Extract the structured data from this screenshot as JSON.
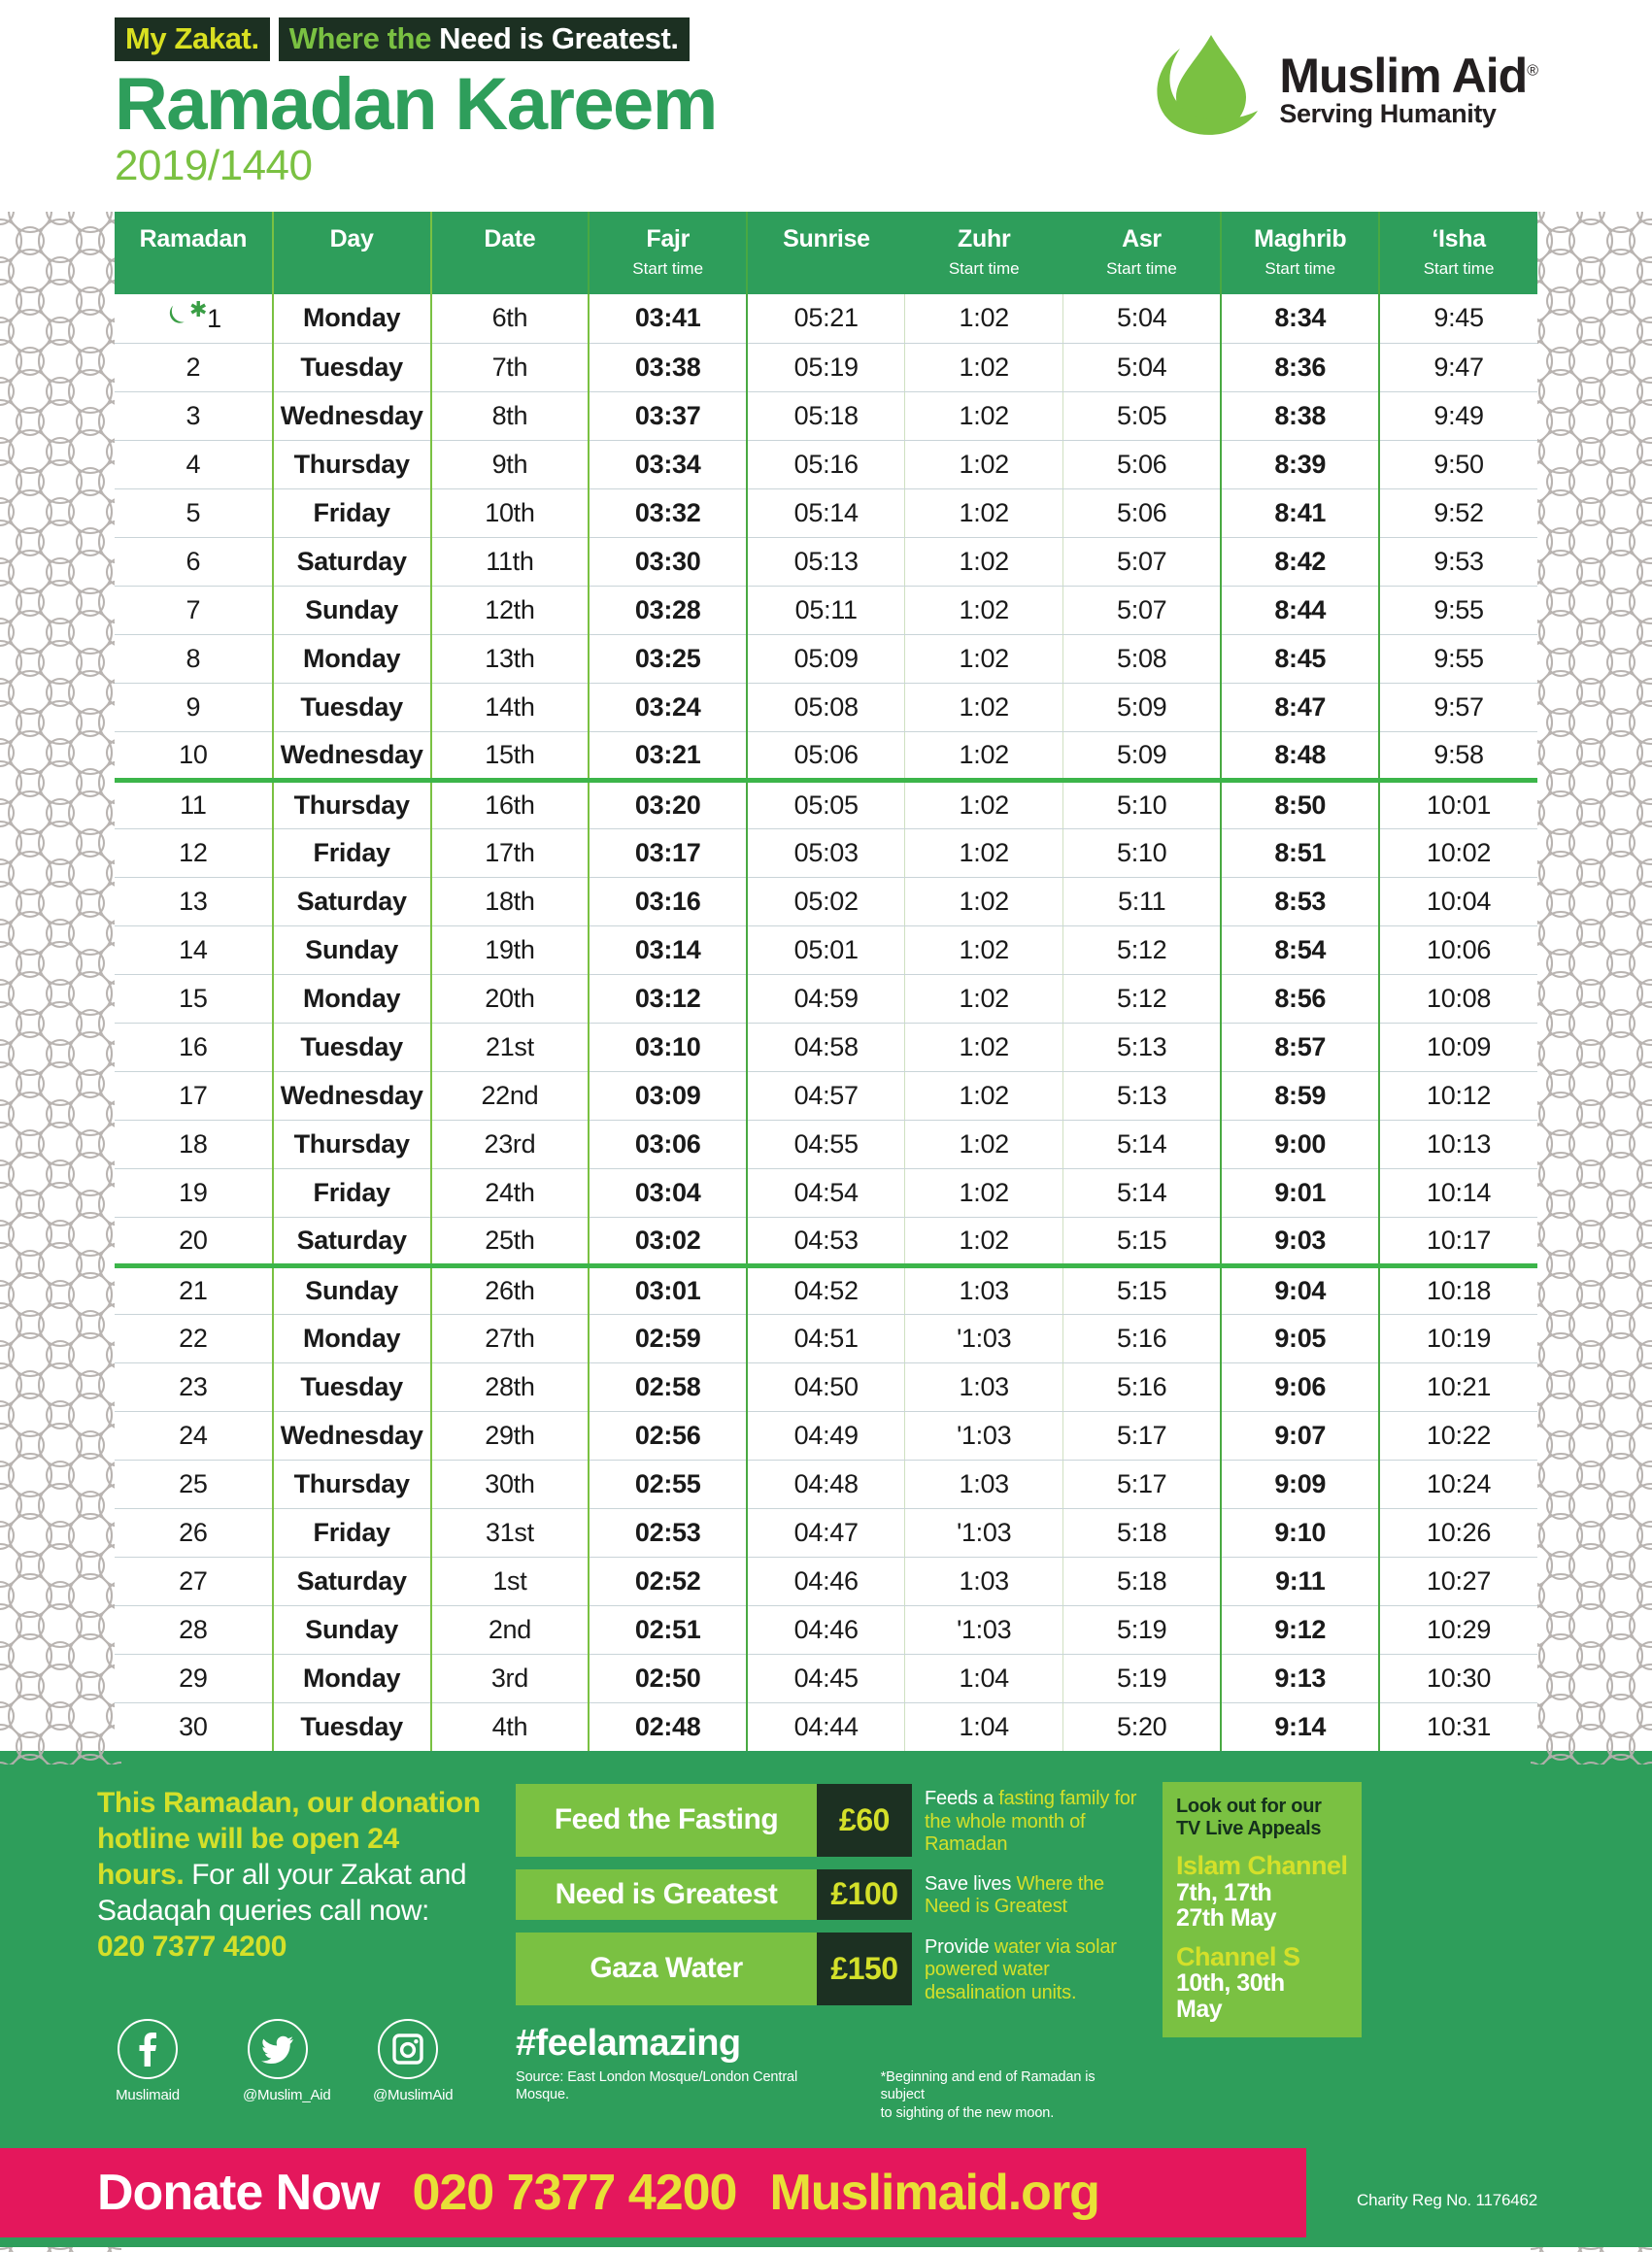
{
  "header": {
    "tagline_part1": "My Zakat.",
    "tagline_part2": "Where the",
    "tagline_part3": "Need is Greatest.",
    "title": "Ramadan Kareem",
    "subtitle": "2019/1440",
    "logo_name": "Muslim Aid",
    "logo_registered": "®",
    "logo_strapline": "Serving Humanity",
    "logo_icon": "droplet-swoosh-logo"
  },
  "table": {
    "columns": [
      {
        "label": "Ramadan",
        "sub": ""
      },
      {
        "label": "Day",
        "sub": ""
      },
      {
        "label": "Date",
        "sub": ""
      },
      {
        "label": "Fajr",
        "sub": "Start time"
      },
      {
        "label": "Sunrise",
        "sub": ""
      },
      {
        "label": "Zuhr",
        "sub": "Start time"
      },
      {
        "label": "Asr",
        "sub": "Start time"
      },
      {
        "label": "Maghrib",
        "sub": "Start time"
      },
      {
        "label": "‘Isha",
        "sub": "Start time"
      }
    ],
    "rows": [
      {
        "ramadan": "1",
        "moon": true,
        "day": "Monday",
        "date": "6th",
        "fajr": "03:41",
        "sunrise": "05:21",
        "zuhr": "1:02",
        "asr": "5:04",
        "maghrib": "8:34",
        "isha": "9:45"
      },
      {
        "ramadan": "2",
        "moon": false,
        "day": "Tuesday",
        "date": "7th",
        "fajr": "03:38",
        "sunrise": "05:19",
        "zuhr": "1:02",
        "asr": "5:04",
        "maghrib": "8:36",
        "isha": "9:47"
      },
      {
        "ramadan": "3",
        "moon": false,
        "day": "Wednesday",
        "date": "8th",
        "fajr": "03:37",
        "sunrise": "05:18",
        "zuhr": "1:02",
        "asr": "5:05",
        "maghrib": "8:38",
        "isha": "9:49"
      },
      {
        "ramadan": "4",
        "moon": false,
        "day": "Thursday",
        "date": "9th",
        "fajr": "03:34",
        "sunrise": "05:16",
        "zuhr": "1:02",
        "asr": "5:06",
        "maghrib": "8:39",
        "isha": "9:50"
      },
      {
        "ramadan": "5",
        "moon": false,
        "day": "Friday",
        "date": "10th",
        "fajr": "03:32",
        "sunrise": "05:14",
        "zuhr": "1:02",
        "asr": "5:06",
        "maghrib": "8:41",
        "isha": "9:52"
      },
      {
        "ramadan": "6",
        "moon": false,
        "day": "Saturday",
        "date": "11th",
        "fajr": "03:30",
        "sunrise": "05:13",
        "zuhr": "1:02",
        "asr": "5:07",
        "maghrib": "8:42",
        "isha": "9:53"
      },
      {
        "ramadan": "7",
        "moon": false,
        "day": "Sunday",
        "date": "12th",
        "fajr": "03:28",
        "sunrise": "05:11",
        "zuhr": "1:02",
        "asr": "5:07",
        "maghrib": "8:44",
        "isha": "9:55"
      },
      {
        "ramadan": "8",
        "moon": false,
        "day": "Monday",
        "date": "13th",
        "fajr": "03:25",
        "sunrise": "05:09",
        "zuhr": "1:02",
        "asr": "5:08",
        "maghrib": "8:45",
        "isha": "9:55"
      },
      {
        "ramadan": "9",
        "moon": false,
        "day": "Tuesday",
        "date": "14th",
        "fajr": "03:24",
        "sunrise": "05:08",
        "zuhr": "1:02",
        "asr": "5:09",
        "maghrib": "8:47",
        "isha": "9:57"
      },
      {
        "ramadan": "10",
        "moon": false,
        "day": "Wednesday",
        "date": "15th",
        "fajr": "03:21",
        "sunrise": "05:06",
        "zuhr": "1:02",
        "asr": "5:09",
        "maghrib": "8:48",
        "isha": "9:58"
      },
      {
        "ramadan": "11",
        "moon": false,
        "day": "Thursday",
        "date": "16th",
        "fajr": "03:20",
        "sunrise": "05:05",
        "zuhr": "1:02",
        "asr": "5:10",
        "maghrib": "8:50",
        "isha": "10:01"
      },
      {
        "ramadan": "12",
        "moon": false,
        "day": "Friday",
        "date": "17th",
        "fajr": "03:17",
        "sunrise": "05:03",
        "zuhr": "1:02",
        "asr": "5:10",
        "maghrib": "8:51",
        "isha": "10:02"
      },
      {
        "ramadan": "13",
        "moon": false,
        "day": "Saturday",
        "date": "18th",
        "fajr": "03:16",
        "sunrise": "05:02",
        "zuhr": "1:02",
        "asr": "5:11",
        "maghrib": "8:53",
        "isha": "10:04"
      },
      {
        "ramadan": "14",
        "moon": false,
        "day": "Sunday",
        "date": "19th",
        "fajr": "03:14",
        "sunrise": "05:01",
        "zuhr": "1:02",
        "asr": "5:12",
        "maghrib": "8:54",
        "isha": "10:06"
      },
      {
        "ramadan": "15",
        "moon": false,
        "day": "Monday",
        "date": "20th",
        "fajr": "03:12",
        "sunrise": "04:59",
        "zuhr": "1:02",
        "asr": "5:12",
        "maghrib": "8:56",
        "isha": "10:08"
      },
      {
        "ramadan": "16",
        "moon": false,
        "day": "Tuesday",
        "date": "21st",
        "fajr": "03:10",
        "sunrise": "04:58",
        "zuhr": "1:02",
        "asr": "5:13",
        "maghrib": "8:57",
        "isha": "10:09"
      },
      {
        "ramadan": "17",
        "moon": false,
        "day": "Wednesday",
        "date": "22nd",
        "fajr": "03:09",
        "sunrise": "04:57",
        "zuhr": "1:02",
        "asr": "5:13",
        "maghrib": "8:59",
        "isha": "10:12"
      },
      {
        "ramadan": "18",
        "moon": false,
        "day": "Thursday",
        "date": "23rd",
        "fajr": "03:06",
        "sunrise": "04:55",
        "zuhr": "1:02",
        "asr": "5:14",
        "maghrib": "9:00",
        "isha": "10:13"
      },
      {
        "ramadan": "19",
        "moon": false,
        "day": "Friday",
        "date": "24th",
        "fajr": "03:04",
        "sunrise": "04:54",
        "zuhr": "1:02",
        "asr": "5:14",
        "maghrib": "9:01",
        "isha": "10:14"
      },
      {
        "ramadan": "20",
        "moon": false,
        "day": "Saturday",
        "date": "25th",
        "fajr": "03:02",
        "sunrise": "04:53",
        "zuhr": "1:02",
        "asr": "5:15",
        "maghrib": "9:03",
        "isha": "10:17"
      },
      {
        "ramadan": "21",
        "moon": false,
        "day": "Sunday",
        "date": "26th",
        "fajr": "03:01",
        "sunrise": "04:52",
        "zuhr": "1:03",
        "asr": "5:15",
        "maghrib": "9:04",
        "isha": "10:18"
      },
      {
        "ramadan": "22",
        "moon": false,
        "day": "Monday",
        "date": "27th",
        "fajr": "02:59",
        "sunrise": "04:51",
        "zuhr": "'1:03",
        "asr": "5:16",
        "maghrib": "9:05",
        "isha": "10:19"
      },
      {
        "ramadan": "23",
        "moon": false,
        "day": "Tuesday",
        "date": "28th",
        "fajr": "02:58",
        "sunrise": "04:50",
        "zuhr": "1:03",
        "asr": "5:16",
        "maghrib": "9:06",
        "isha": "10:21"
      },
      {
        "ramadan": "24",
        "moon": false,
        "day": "Wednesday",
        "date": "29th",
        "fajr": "02:56",
        "sunrise": "04:49",
        "zuhr": "'1:03",
        "asr": "5:17",
        "maghrib": "9:07",
        "isha": "10:22"
      },
      {
        "ramadan": "25",
        "moon": false,
        "day": "Thursday",
        "date": "30th",
        "fajr": "02:55",
        "sunrise": "04:48",
        "zuhr": "1:03",
        "asr": "5:17",
        "maghrib": "9:09",
        "isha": "10:24"
      },
      {
        "ramadan": "26",
        "moon": false,
        "day": "Friday",
        "date": "31st",
        "fajr": "02:53",
        "sunrise": "04:47",
        "zuhr": "'1:03",
        "asr": "5:18",
        "maghrib": "9:10",
        "isha": "10:26"
      },
      {
        "ramadan": "27",
        "moon": false,
        "day": "Saturday",
        "date": "1st",
        "fajr": "02:52",
        "sunrise": "04:46",
        "zuhr": "1:03",
        "asr": "5:18",
        "maghrib": "9:11",
        "isha": "10:27"
      },
      {
        "ramadan": "28",
        "moon": false,
        "day": "Sunday",
        "date": "2nd",
        "fajr": "02:51",
        "sunrise": "04:46",
        "zuhr": "'1:03",
        "asr": "5:19",
        "maghrib": "9:12",
        "isha": "10:29"
      },
      {
        "ramadan": "29",
        "moon": false,
        "day": "Monday",
        "date": "3rd",
        "fajr": "02:50",
        "sunrise": "04:45",
        "zuhr": "1:04",
        "asr": "5:19",
        "maghrib": "9:13",
        "isha": "10:30"
      },
      {
        "ramadan": "30",
        "moon": false,
        "day": "Tuesday",
        "date": "4th",
        "fajr": "02:48",
        "sunrise": "04:44",
        "zuhr": "1:04",
        "asr": "5:20",
        "maghrib": "9:14",
        "isha": "10:31"
      }
    ]
  },
  "footer": {
    "hotline_1": "This Ramadan, our donation",
    "hotline_2": "hotline will be open 24",
    "hotline_3a": "hours.",
    "hotline_3b": " For all your Zakat and",
    "hotline_4": "Sadaqah queries call now:",
    "hotline_phone": "020 7377 4200",
    "socials": [
      {
        "icon": "facebook-icon",
        "label": "Muslimaid"
      },
      {
        "icon": "twitter-icon",
        "label": "@Muslim_Aid"
      },
      {
        "icon": "instagram-icon",
        "label": "@MuslimAid"
      }
    ],
    "donations": [
      {
        "name": "Feed the Fasting",
        "amount": "£60",
        "desc_white": "Feeds a ",
        "desc_yellow": "fasting family for the whole month of Ramadan"
      },
      {
        "name": "Need is Greatest",
        "amount": "£100",
        "desc_white": "Save lives ",
        "desc_yellow": "Where the Need is Greatest"
      },
      {
        "name": "Gaza Water",
        "amount": "£150",
        "desc_white": "Provide ",
        "desc_yellow": "water via solar powered water desalination units."
      }
    ],
    "hashtag": "#feelamazing",
    "source_note": "Source: East London Mosque/London Central Mosque.",
    "moon_note_1": "*Beginning and end of Ramadan is subject",
    "moon_note_2": "to sighting of the new moon.",
    "tv": {
      "heading_1": "Look out for our",
      "heading_2": "TV Live Appeals",
      "channel_1": "Islam Channel",
      "dates_1a": "7th, 17th",
      "dates_1b": "27th May",
      "channel_2": "Channel S",
      "dates_2a": "10th, 30th",
      "dates_2b": "May"
    }
  },
  "donate_bar": {
    "label": "Donate Now",
    "phone": "020 7377 4200",
    "website": "Muslimaid.org",
    "charity_reg": "Charity Reg No. 1176462"
  },
  "colors": {
    "green_dark": "#2e9e5b",
    "green_light": "#7ac142",
    "yellow": "#d4e02a",
    "pink": "#e4175c",
    "magenta": "#e6007e",
    "near_black": "#1c3022"
  }
}
